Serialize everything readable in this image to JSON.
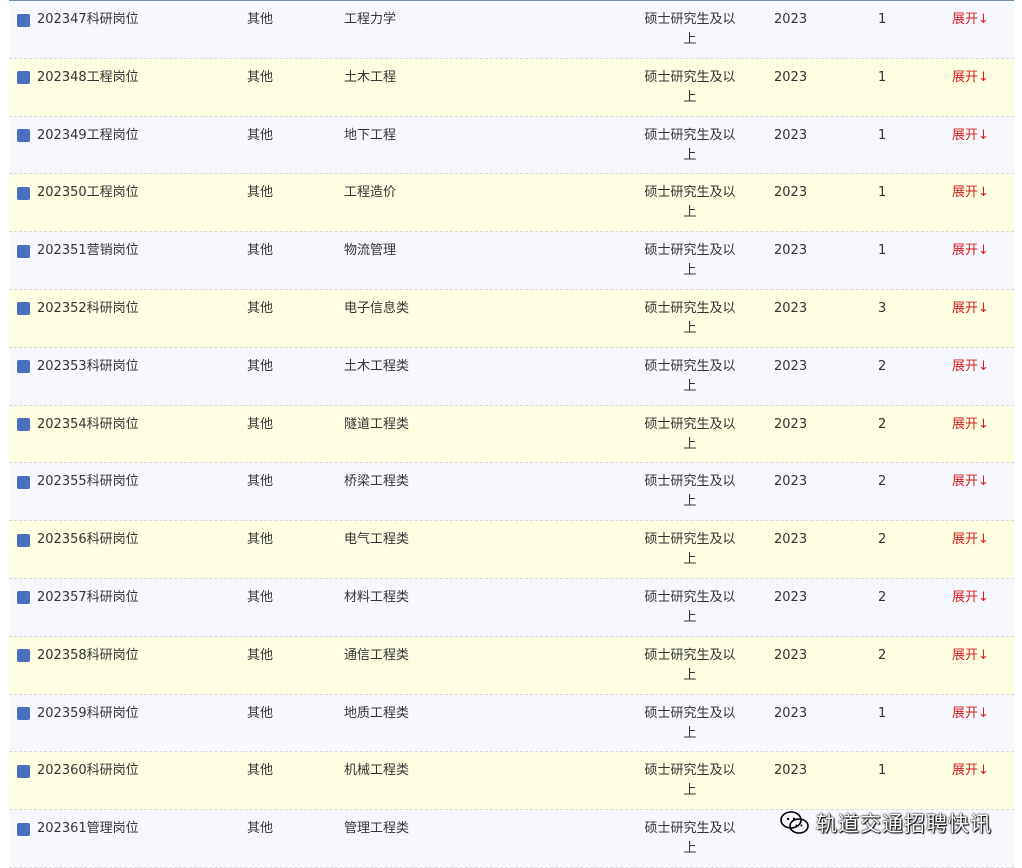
{
  "rows": [
    {
      "code": "202347科研岗位",
      "type": "其他",
      "major": "工程力学",
      "edu": "硕士研究生及以上",
      "year": "2023",
      "num": "1",
      "expand": "展开↓"
    },
    {
      "code": "202348工程岗位",
      "type": "其他",
      "major": "土木工程",
      "edu": "硕士研究生及以上",
      "year": "2023",
      "num": "1",
      "expand": "展开↓"
    },
    {
      "code": "202349工程岗位",
      "type": "其他",
      "major": "地下工程",
      "edu": "硕士研究生及以上",
      "year": "2023",
      "num": "1",
      "expand": "展开↓"
    },
    {
      "code": "202350工程岗位",
      "type": "其他",
      "major": "工程造价",
      "edu": "硕士研究生及以上",
      "year": "2023",
      "num": "1",
      "expand": "展开↓"
    },
    {
      "code": "202351营销岗位",
      "type": "其他",
      "major": "物流管理",
      "edu": "硕士研究生及以上",
      "year": "2023",
      "num": "1",
      "expand": "展开↓"
    },
    {
      "code": "202352科研岗位",
      "type": "其他",
      "major": "电子信息类",
      "edu": "硕士研究生及以上",
      "year": "2023",
      "num": "3",
      "expand": "展开↓"
    },
    {
      "code": "202353科研岗位",
      "type": "其他",
      "major": "土木工程类",
      "edu": "硕士研究生及以上",
      "year": "2023",
      "num": "2",
      "expand": "展开↓"
    },
    {
      "code": "202354科研岗位",
      "type": "其他",
      "major": "隧道工程类",
      "edu": "硕士研究生及以上",
      "year": "2023",
      "num": "2",
      "expand": "展开↓"
    },
    {
      "code": "202355科研岗位",
      "type": "其他",
      "major": "桥梁工程类",
      "edu": "硕士研究生及以上",
      "year": "2023",
      "num": "2",
      "expand": "展开↓"
    },
    {
      "code": "202356科研岗位",
      "type": "其他",
      "major": "电气工程类",
      "edu": "硕士研究生及以上",
      "year": "2023",
      "num": "2",
      "expand": "展开↓"
    },
    {
      "code": "202357科研岗位",
      "type": "其他",
      "major": "材料工程类",
      "edu": "硕士研究生及以上",
      "year": "2023",
      "num": "2",
      "expand": "展开↓"
    },
    {
      "code": "202358科研岗位",
      "type": "其他",
      "major": "通信工程类",
      "edu": "硕士研究生及以上",
      "year": "2023",
      "num": "2",
      "expand": "展开↓"
    },
    {
      "code": "202359科研岗位",
      "type": "其他",
      "major": "地质工程类",
      "edu": "硕士研究生及以上",
      "year": "2023",
      "num": "1",
      "expand": "展开↓"
    },
    {
      "code": "202360科研岗位",
      "type": "其他",
      "major": "机械工程类",
      "edu": "硕士研究生及以上",
      "year": "2023",
      "num": "1",
      "expand": "展开↓"
    },
    {
      "code": "202361管理岗位",
      "type": "其他",
      "major": "管理工程类",
      "edu": "硕士研究生及以上",
      "year": "",
      "num": "",
      "expand": ""
    }
  ],
  "watermark": {
    "text": "轨道交通招聘快讯",
    "icon": "wechat-icon"
  },
  "colors": {
    "checkbox": "#4a6fbe",
    "expand": "#d81e1e",
    "row_odd": "#f7f8fe",
    "row_even": "#fefee2"
  }
}
